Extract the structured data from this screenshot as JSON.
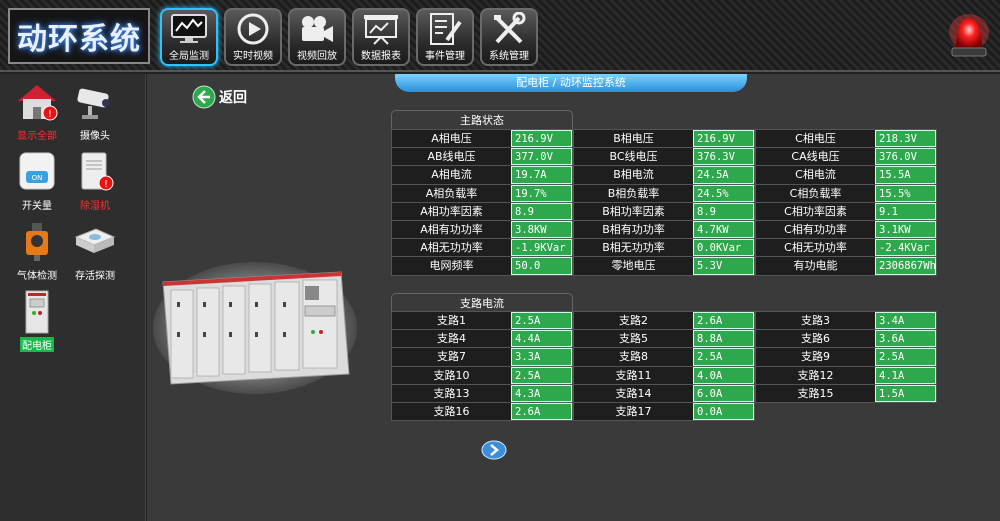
{
  "header": {
    "logo": "动环系统",
    "nav": [
      {
        "label": "全局监测",
        "icon": "monitor-chart-icon",
        "active": true
      },
      {
        "label": "实时视频",
        "icon": "play-icon",
        "active": false
      },
      {
        "label": "视频回放",
        "icon": "video-camera-icon",
        "active": false
      },
      {
        "label": "数据报表",
        "icon": "presentation-board-icon",
        "active": false
      },
      {
        "label": "事件管理",
        "icon": "clipboard-pen-icon",
        "active": false
      },
      {
        "label": "系统管理",
        "icon": "tools-icon",
        "active": false
      }
    ]
  },
  "sidebar": {
    "items": [
      {
        "label": "显示全部",
        "icon": "house-alert-icon",
        "alarm": true
      },
      {
        "label": "摄像头",
        "icon": "security-camera-icon",
        "alarm": false
      },
      {
        "label": "开关量",
        "icon": "switch-on-icon",
        "alarm": false
      },
      {
        "label": "除湿机",
        "icon": "dehumidifier-alert-icon",
        "alarm": true
      },
      {
        "label": "气体检测",
        "icon": "gas-detector-icon",
        "alarm": false
      },
      {
        "label": "存活探测",
        "icon": "presence-detector-icon",
        "alarm": false
      },
      {
        "label": "配电柜",
        "icon": "power-cabinet-icon",
        "alarm": false,
        "selected": true
      }
    ]
  },
  "main": {
    "title": "配电柜 / 动环监控系统",
    "back_label": "返回",
    "main_status": {
      "title": "主路状态",
      "rows": [
        [
          {
            "label": "A相电压",
            "value": "216.9V"
          },
          {
            "label": "B相电压",
            "value": "216.9V"
          },
          {
            "label": "C相电压",
            "value": "218.3V"
          }
        ],
        [
          {
            "label": "AB线电压",
            "value": "377.0V"
          },
          {
            "label": "BC线电压",
            "value": "376.3V"
          },
          {
            "label": "CA线电压",
            "value": "376.0V"
          }
        ],
        [
          {
            "label": "A相电流",
            "value": "19.7A"
          },
          {
            "label": "B相电流",
            "value": "24.5A"
          },
          {
            "label": "C相电流",
            "value": "15.5A"
          }
        ],
        [
          {
            "label": "A相负载率",
            "value": "19.7%"
          },
          {
            "label": "B相负载率",
            "value": "24.5%"
          },
          {
            "label": "C相负载率",
            "value": "15.5%"
          }
        ],
        [
          {
            "label": "A相功率因素",
            "value": "8.9"
          },
          {
            "label": "B相功率因素",
            "value": "8.9"
          },
          {
            "label": "C相功率因素",
            "value": "9.1"
          }
        ],
        [
          {
            "label": "A相有功功率",
            "value": "3.8KW"
          },
          {
            "label": "B相有功功率",
            "value": "4.7KW"
          },
          {
            "label": "C相有功功率",
            "value": "3.1KW"
          }
        ],
        [
          {
            "label": "A相无功功率",
            "value": "-1.9KVar"
          },
          {
            "label": "B相无功功率",
            "value": "0.0KVar"
          },
          {
            "label": "C相无功功率",
            "value": "-2.4KVar"
          }
        ],
        [
          {
            "label": "电网频率",
            "value": "50.0"
          },
          {
            "label": "零地电压",
            "value": "5.3V"
          },
          {
            "label": "有功电能",
            "value": "2306867Wh"
          }
        ]
      ]
    },
    "branch_current": {
      "title": "支路电流",
      "rows": [
        [
          {
            "label": "支路1",
            "value": "2.5A"
          },
          {
            "label": "支路2",
            "value": "2.6A"
          },
          {
            "label": "支路3",
            "value": "3.4A"
          }
        ],
        [
          {
            "label": "支路4",
            "value": "4.4A"
          },
          {
            "label": "支路5",
            "value": "8.8A"
          },
          {
            "label": "支路6",
            "value": "3.6A"
          }
        ],
        [
          {
            "label": "支路7",
            "value": "3.3A"
          },
          {
            "label": "支路8",
            "value": "2.5A"
          },
          {
            "label": "支路9",
            "value": "2.5A"
          }
        ],
        [
          {
            "label": "支路10",
            "value": "2.5A"
          },
          {
            "label": "支路11",
            "value": "4.0A"
          },
          {
            "label": "支路12",
            "value": "4.1A"
          }
        ],
        [
          {
            "label": "支路13",
            "value": "4.3A"
          },
          {
            "label": "支路14",
            "value": "6.0A"
          },
          {
            "label": "支路15",
            "value": "1.5A"
          }
        ],
        [
          {
            "label": "支路16",
            "value": "2.6A"
          },
          {
            "label": "支路17",
            "value": "0.0A"
          }
        ]
      ]
    }
  },
  "colors": {
    "value_bg": "#2ea84c",
    "title_bar": "#2a8fd8",
    "selected": "#18b84a",
    "alarm": "#ff3030"
  }
}
